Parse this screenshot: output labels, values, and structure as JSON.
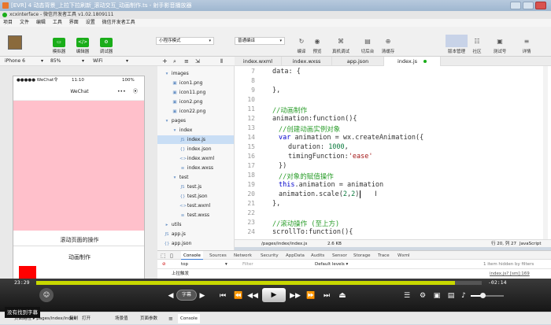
{
  "window": {
    "title": "[EVR] 4 动态背景_上拉下拉刷新_滚动交互_动画制作.ts - 射手影音播放器",
    "inner_title": "xcxinterface - 微信开发者工具 v1.02.1809111"
  },
  "menu": [
    "项目",
    "文件",
    "编辑",
    "工具",
    "界面",
    "设置",
    "微信开发者工具"
  ],
  "toolbar": {
    "simulator": "模拟器",
    "editor": "编辑器",
    "debugger": "调试器",
    "mode": "小程序模式",
    "compile_mode": "普通编译",
    "compile": "编译",
    "preview": "预览",
    "real_debug": "真机调试",
    "switch_bg": "切后台",
    "clear_cache": "清缓存",
    "version": "版本管理",
    "community": "社区",
    "test": "测试号",
    "details": "详情"
  },
  "devicebar": {
    "device": "iPhone 6",
    "zoom": "85%",
    "network": "WiFi"
  },
  "phone": {
    "carrier": "●●●●● WeChat令",
    "time": "11:10",
    "battery": "100%",
    "nav_title": "WeChat",
    "nav_dots": "•••",
    "nav_target": "⦿",
    "button1": "滚动页面的操作",
    "button2": "动画制作"
  },
  "filetree": [
    {
      "indent": 0,
      "icon": "▾",
      "label": "images"
    },
    {
      "indent": 1,
      "icon": "▣",
      "label": "icon1.png"
    },
    {
      "indent": 1,
      "icon": "▣",
      "label": "icon11.png"
    },
    {
      "indent": 1,
      "icon": "▣",
      "label": "icon2.png"
    },
    {
      "indent": 1,
      "icon": "▣",
      "label": "icon22.png"
    },
    {
      "indent": 0,
      "icon": "▾",
      "label": "pages"
    },
    {
      "indent": 1,
      "icon": "▾",
      "label": "index"
    },
    {
      "indent": 2,
      "icon": "JS",
      "label": "index.js",
      "selected": true
    },
    {
      "indent": 2,
      "icon": "{}",
      "label": "index.json"
    },
    {
      "indent": 2,
      "icon": "<>",
      "label": "index.wxml"
    },
    {
      "indent": 2,
      "icon": "≡",
      "label": "index.wxss"
    },
    {
      "indent": 1,
      "icon": "▾",
      "label": "test"
    },
    {
      "indent": 2,
      "icon": "JS",
      "label": "test.js"
    },
    {
      "indent": 2,
      "icon": "{}",
      "label": "test.json"
    },
    {
      "indent": 2,
      "icon": "<>",
      "label": "test.wxml"
    },
    {
      "indent": 2,
      "icon": "≡",
      "label": "test.wxss"
    },
    {
      "indent": 0,
      "icon": "▸",
      "label": "utils"
    },
    {
      "indent": 0,
      "icon": "JS",
      "label": "app.js"
    },
    {
      "indent": 0,
      "icon": "{}",
      "label": "app.json"
    }
  ],
  "tabs": [
    "index.wxml",
    "index.wxss",
    "app.json",
    "index.js"
  ],
  "code": {
    "lines": [
      "7",
      "8",
      "9",
      "10",
      "11",
      "12",
      "13",
      "14",
      "15",
      "16",
      "17",
      "18",
      "19",
      "20",
      "21",
      "22",
      "23",
      "24"
    ],
    "l7": "data: {",
    "l9": "},",
    "l11": "//动画制作",
    "l12": "animation:function(){",
    "l13": "//创建动画实例对象",
    "l14a": "var",
    "l14b": " animation = wx.createAnimation({",
    "l15a": "duration: ",
    "l15b": "1000",
    "l15c": ",",
    "l16a": "timingFunction:",
    "l16b": "'ease'",
    "l17": "})",
    "l18": "//对象的赋值操作",
    "l19a": "this",
    "l19b": ".animation = animation",
    "l20a": "animation.scale(",
    "l20b": "2",
    "l20c": ",",
    "l20d": "2",
    "l20e": ")",
    "l21": "},",
    "l23": "//滚动操作 (至上方)",
    "l24": "scrollTo:function(){"
  },
  "editor_status": {
    "path": "/pages/index/index.js",
    "size": "2.6 KB",
    "position": "行 20, 列 27",
    "lang": "JavaScript"
  },
  "devtools": {
    "tabs": [
      "Console",
      "Sources",
      "Network",
      "Security",
      "AppData",
      "Audits",
      "Sensor",
      "Storage",
      "Trace",
      "Wxml"
    ],
    "top": "top",
    "filter": "Filter",
    "levels": "Default levels ▾",
    "hidden": "1 item hidden by filters",
    "log": "上拉触发",
    "log_src": "index.js? [sm]:169"
  },
  "player": {
    "elapsed": "23:29",
    "remaining": "-02:14",
    "subtitle": "字幕",
    "no_subtitle": "没有找到字幕",
    "progress": 0.94,
    "volume": 0.35
  },
  "bottombar": {
    "path": "页面路径 ▸ pages/index/index",
    "copy": "复制",
    "open": "打开",
    "scene": "场景值",
    "params": "页面参数",
    "console": "Console"
  }
}
